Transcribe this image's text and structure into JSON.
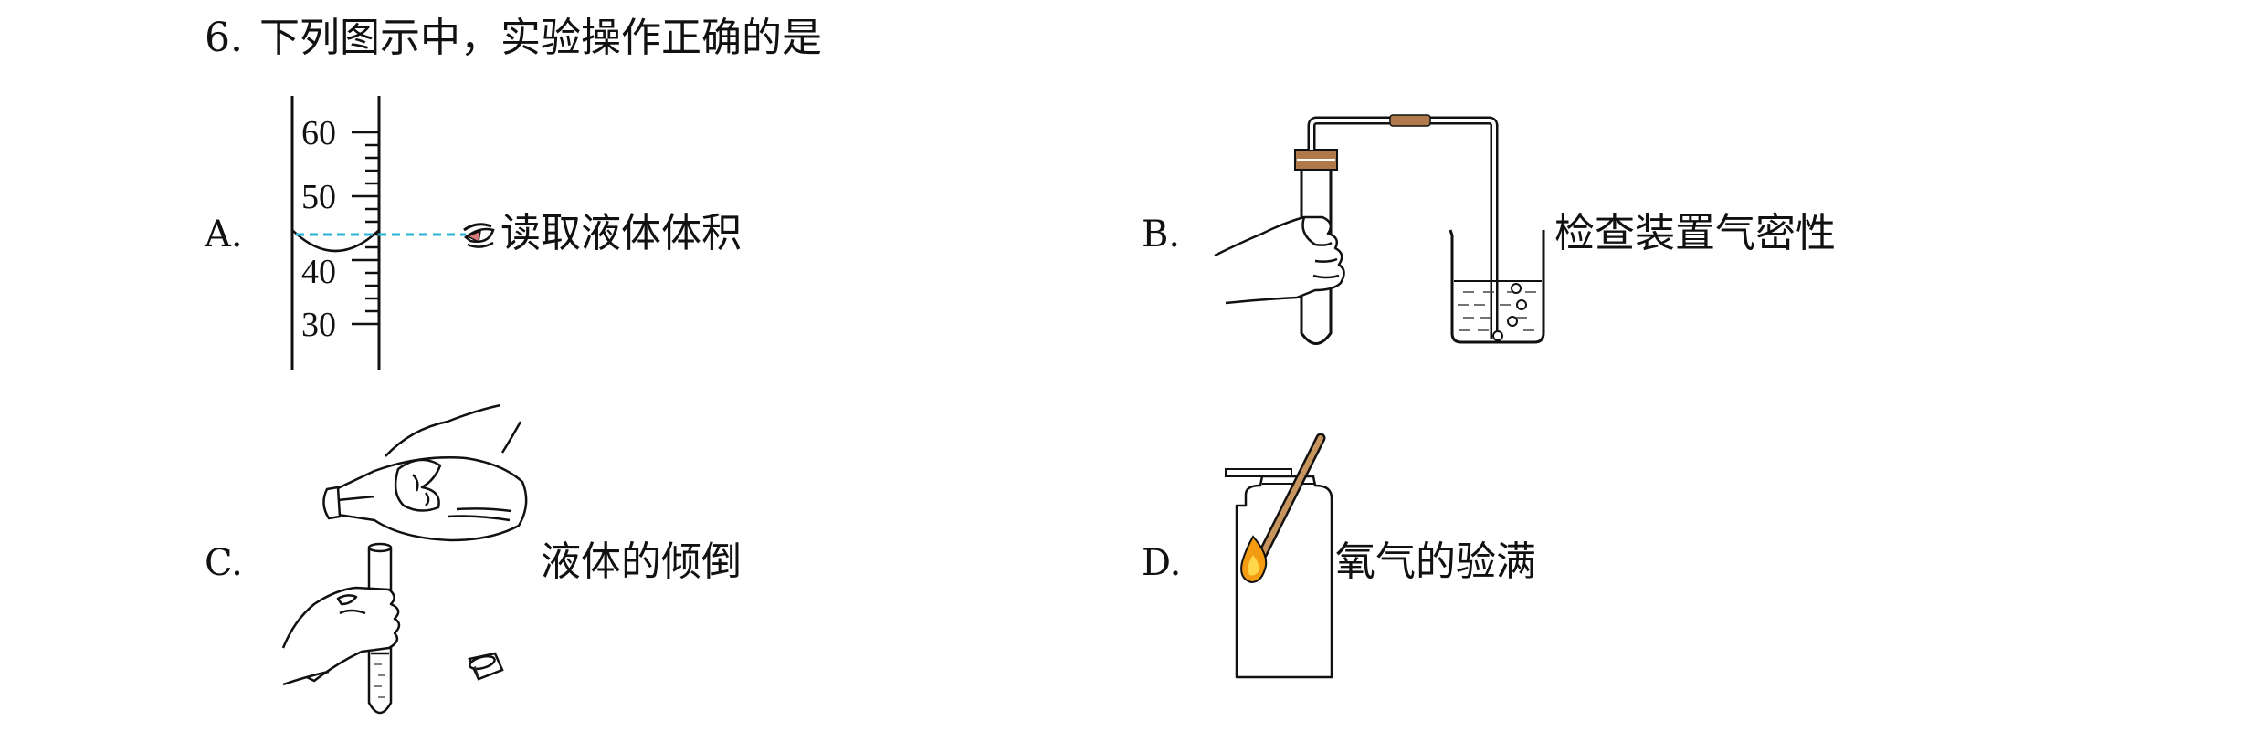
{
  "question": {
    "number": "6.",
    "text": "下列图示中，实验操作正确的是"
  },
  "options": [
    {
      "letter": "A.",
      "caption": "读取液体体积",
      "scale_labels": [
        "60",
        "50",
        "40",
        "30"
      ]
    },
    {
      "letter": "B.",
      "caption": "检查装置气密性"
    },
    {
      "letter": "C.",
      "caption": "液体的倾倒"
    },
    {
      "letter": "D.",
      "caption": "氧气的验满"
    }
  ],
  "colors": {
    "sight_line": "#2bb1d6",
    "stopper": "#b07a4a",
    "flame": "#f39c12",
    "stick": "#c9955f"
  }
}
